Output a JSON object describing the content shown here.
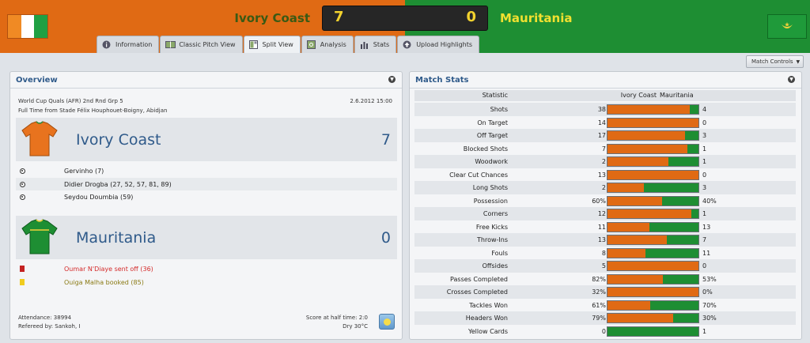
{
  "header": {
    "home_team": "Ivory Coast",
    "away_team": "Mauritania",
    "home_score": "7",
    "away_score": "0",
    "colors": {
      "home": "#e06a14",
      "away": "#1e8e33",
      "score_text": "#f2d22e"
    }
  },
  "tabs": [
    {
      "label": "Information",
      "icon": "info-icon",
      "active": false
    },
    {
      "label": "Classic Pitch View",
      "icon": "pitch-icon",
      "active": false
    },
    {
      "label": "Split View",
      "icon": "split-view-icon",
      "active": true
    },
    {
      "label": "Analysis",
      "icon": "analysis-icon",
      "active": false
    },
    {
      "label": "Stats",
      "icon": "stats-icon",
      "active": false
    },
    {
      "label": "Upload Highlights",
      "icon": "upload-icon",
      "active": false
    }
  ],
  "controls": {
    "match_controls_label": "Match Controls"
  },
  "overview": {
    "title": "Overview",
    "competition": "World Cup Quals (AFR) 2nd Rnd Grp 5",
    "date": "2.6.2012 15:00",
    "venue": "Full Time from Stade Félix Houphouet-Boigny, Abidjan",
    "home": {
      "name": "Ivory Coast",
      "score": "7",
      "events": [
        {
          "type": "goal",
          "text": "Gervinho (7)"
        },
        {
          "type": "goal",
          "text": "Didier Drogba (27, 52, 57, 81, 89)"
        },
        {
          "type": "goal",
          "text": "Seydou Doumbia (59)"
        }
      ]
    },
    "away": {
      "name": "Mauritania",
      "score": "0",
      "events": [
        {
          "type": "red-card",
          "text": "Oumar N'Diaye sent off (36)"
        },
        {
          "type": "yellow-card",
          "text": "Ouiga Malha booked (85)"
        }
      ]
    },
    "attendance": "Attendance: 38994",
    "referee": "Refereed by: Sankoh, I",
    "half_time": "Score at half time: 2:0",
    "weather": "Dry 30°C"
  },
  "match_stats": {
    "title": "Match Stats",
    "headers": {
      "statistic": "Statistic",
      "home": "Ivory Coast",
      "away": "Mauritania"
    },
    "rows": [
      {
        "name": "Shots",
        "home": "38",
        "away": "4",
        "home_share": 0.905
      },
      {
        "name": "On Target",
        "home": "14",
        "away": "0",
        "home_share": 1.0
      },
      {
        "name": "Off Target",
        "home": "17",
        "away": "3",
        "home_share": 0.85
      },
      {
        "name": "Blocked Shots",
        "home": "7",
        "away": "1",
        "home_share": 0.875
      },
      {
        "name": "Woodwork",
        "home": "2",
        "away": "1",
        "home_share": 0.667
      },
      {
        "name": "Clear Cut Chances",
        "home": "13",
        "away": "0",
        "home_share": 1.0
      },
      {
        "name": "Long Shots",
        "home": "2",
        "away": "3",
        "home_share": 0.4
      },
      {
        "name": "Possession",
        "home": "60%",
        "away": "40%",
        "home_share": 0.6
      },
      {
        "name": "Corners",
        "home": "12",
        "away": "1",
        "home_share": 0.923
      },
      {
        "name": "Free Kicks",
        "home": "11",
        "away": "13",
        "home_share": 0.458
      },
      {
        "name": "Throw-Ins",
        "home": "13",
        "away": "7",
        "home_share": 0.65
      },
      {
        "name": "Fouls",
        "home": "8",
        "away": "11",
        "home_share": 0.421
      },
      {
        "name": "Offsides",
        "home": "5",
        "away": "0",
        "home_share": 1.0
      },
      {
        "name": "Passes Completed",
        "home": "82%",
        "away": "53%",
        "home_share": 0.607
      },
      {
        "name": "Crosses Completed",
        "home": "32%",
        "away": "0%",
        "home_share": 1.0
      },
      {
        "name": "Tackles Won",
        "home": "61%",
        "away": "70%",
        "home_share": 0.466
      },
      {
        "name": "Headers Won",
        "home": "79%",
        "away": "30%",
        "home_share": 0.725
      },
      {
        "name": "Yellow Cards",
        "home": "0",
        "away": "1",
        "home_share": 0.0
      }
    ]
  }
}
